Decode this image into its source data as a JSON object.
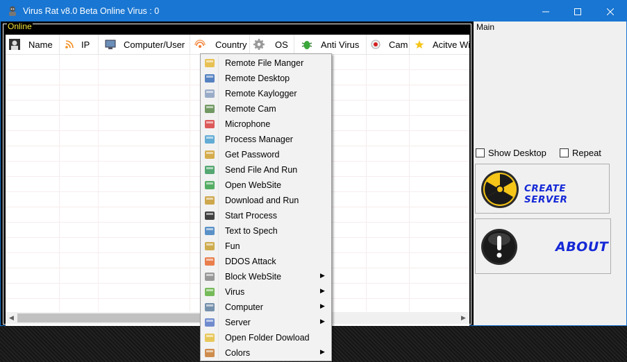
{
  "window": {
    "title": "Virus Rat v8.0 Beta Online Virus : 0"
  },
  "online": {
    "label": "Online",
    "columns": [
      {
        "label": "Name",
        "icon": "user-icon"
      },
      {
        "label": "IP",
        "icon": "rss-icon"
      },
      {
        "label": "Computer/User",
        "icon": "monitor-icon"
      },
      {
        "label": "Country",
        "icon": "signal-icon"
      },
      {
        "label": "OS",
        "icon": "gear-icon"
      },
      {
        "label": "Anti Virus",
        "icon": "bug-icon"
      },
      {
        "label": "Cam",
        "icon": "record-icon"
      },
      {
        "label": "Acitve Wi",
        "icon": "star-icon"
      }
    ]
  },
  "main": {
    "label": "Main",
    "show_desktop": "Show Desktop",
    "repeat": "Repeat",
    "create_server": "CREATE SERVER",
    "about": "ABOUT"
  },
  "context_menu": {
    "items": [
      {
        "label": "Remote File Manger",
        "icon": "folder-icon",
        "submenu": false
      },
      {
        "label": "Remote Desktop",
        "icon": "desktop-icon",
        "submenu": false
      },
      {
        "label": "Remote Kaylogger",
        "icon": "keyboard-icon",
        "submenu": false
      },
      {
        "label": "Remote Cam",
        "icon": "webcam-icon",
        "submenu": false
      },
      {
        "label": "Microphone",
        "icon": "microphone-icon",
        "submenu": false
      },
      {
        "label": "Process Manager",
        "icon": "pie-icon",
        "submenu": false
      },
      {
        "label": "Get Password",
        "icon": "password-icon",
        "submenu": false
      },
      {
        "label": "Send File And Run",
        "icon": "send-icon",
        "submenu": false
      },
      {
        "label": "Open WebSite",
        "icon": "globe-icon",
        "submenu": false
      },
      {
        "label": "Download and Run",
        "icon": "download-icon",
        "submenu": false
      },
      {
        "label": "Start Process",
        "icon": "terminal-icon",
        "submenu": false
      },
      {
        "label": "Text to Spech",
        "icon": "speech-icon",
        "submenu": false
      },
      {
        "label": "Fun",
        "icon": "wand-icon",
        "submenu": false
      },
      {
        "label": "DDOS Attack",
        "icon": "attack-icon",
        "submenu": false
      },
      {
        "label": "Block WebSite",
        "icon": "eye-icon",
        "submenu": true
      },
      {
        "label": "Virus",
        "icon": "puzzle-icon",
        "submenu": true
      },
      {
        "label": "Computer",
        "icon": "computer-icon",
        "submenu": true
      },
      {
        "label": "Server",
        "icon": "server-icon",
        "submenu": true
      },
      {
        "label": "Open Folder Dowload",
        "icon": "open-folder-icon",
        "submenu": false
      },
      {
        "label": "Colors",
        "icon": "palette-icon",
        "submenu": true
      }
    ]
  }
}
